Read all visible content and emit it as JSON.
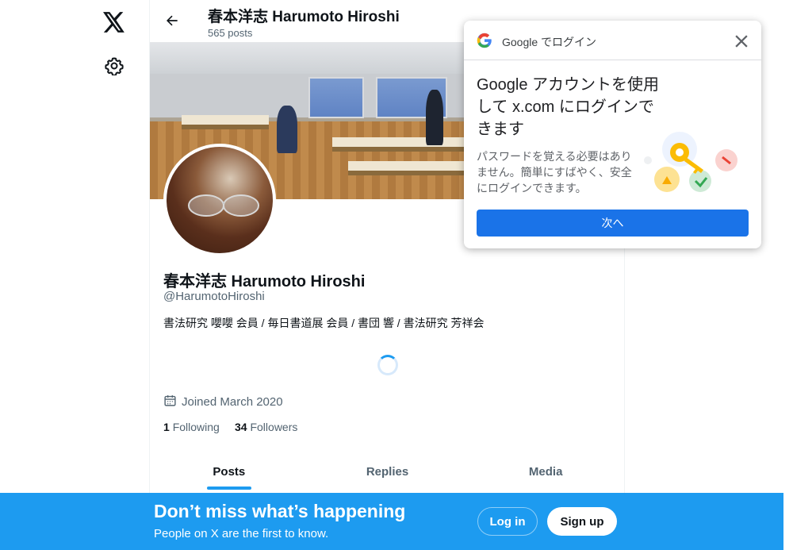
{
  "nav": {
    "x_logo": "x-logo-icon",
    "settings": "gear-icon"
  },
  "header": {
    "title": "春本洋志 Harumoto Hiroshi",
    "posts_count": "565 posts"
  },
  "profile": {
    "name": "春本洋志 Harumoto Hiroshi",
    "handle": "@HarumotoHiroshi",
    "bio": "書法研究 嚶嚶 会員 / 毎日書道展 会員 / 書団 響 / 書法研究 芳祥会",
    "joined": "Joined March 2020",
    "following_count": "1",
    "following_label": "Following",
    "followers_count": "34",
    "followers_label": "Followers"
  },
  "tabs": [
    {
      "label": "Posts",
      "active": true
    },
    {
      "label": "Replies",
      "active": false
    },
    {
      "label": "Media",
      "active": false
    }
  ],
  "bottom_banner": {
    "title": "Don’t miss what’s happening",
    "subtitle": "People on X are the first to know.",
    "login": "Log in",
    "signup": "Sign up",
    "color": "#1d9bf0"
  },
  "google_popup": {
    "header": "Google でログイン",
    "title": "Google アカウントを使用して x.com にログインできます",
    "body": "パスワードを覚える必要はありません。簡単にすばやく、安全にログインできます。",
    "next": "次へ",
    "accent": "#1a73e8"
  }
}
